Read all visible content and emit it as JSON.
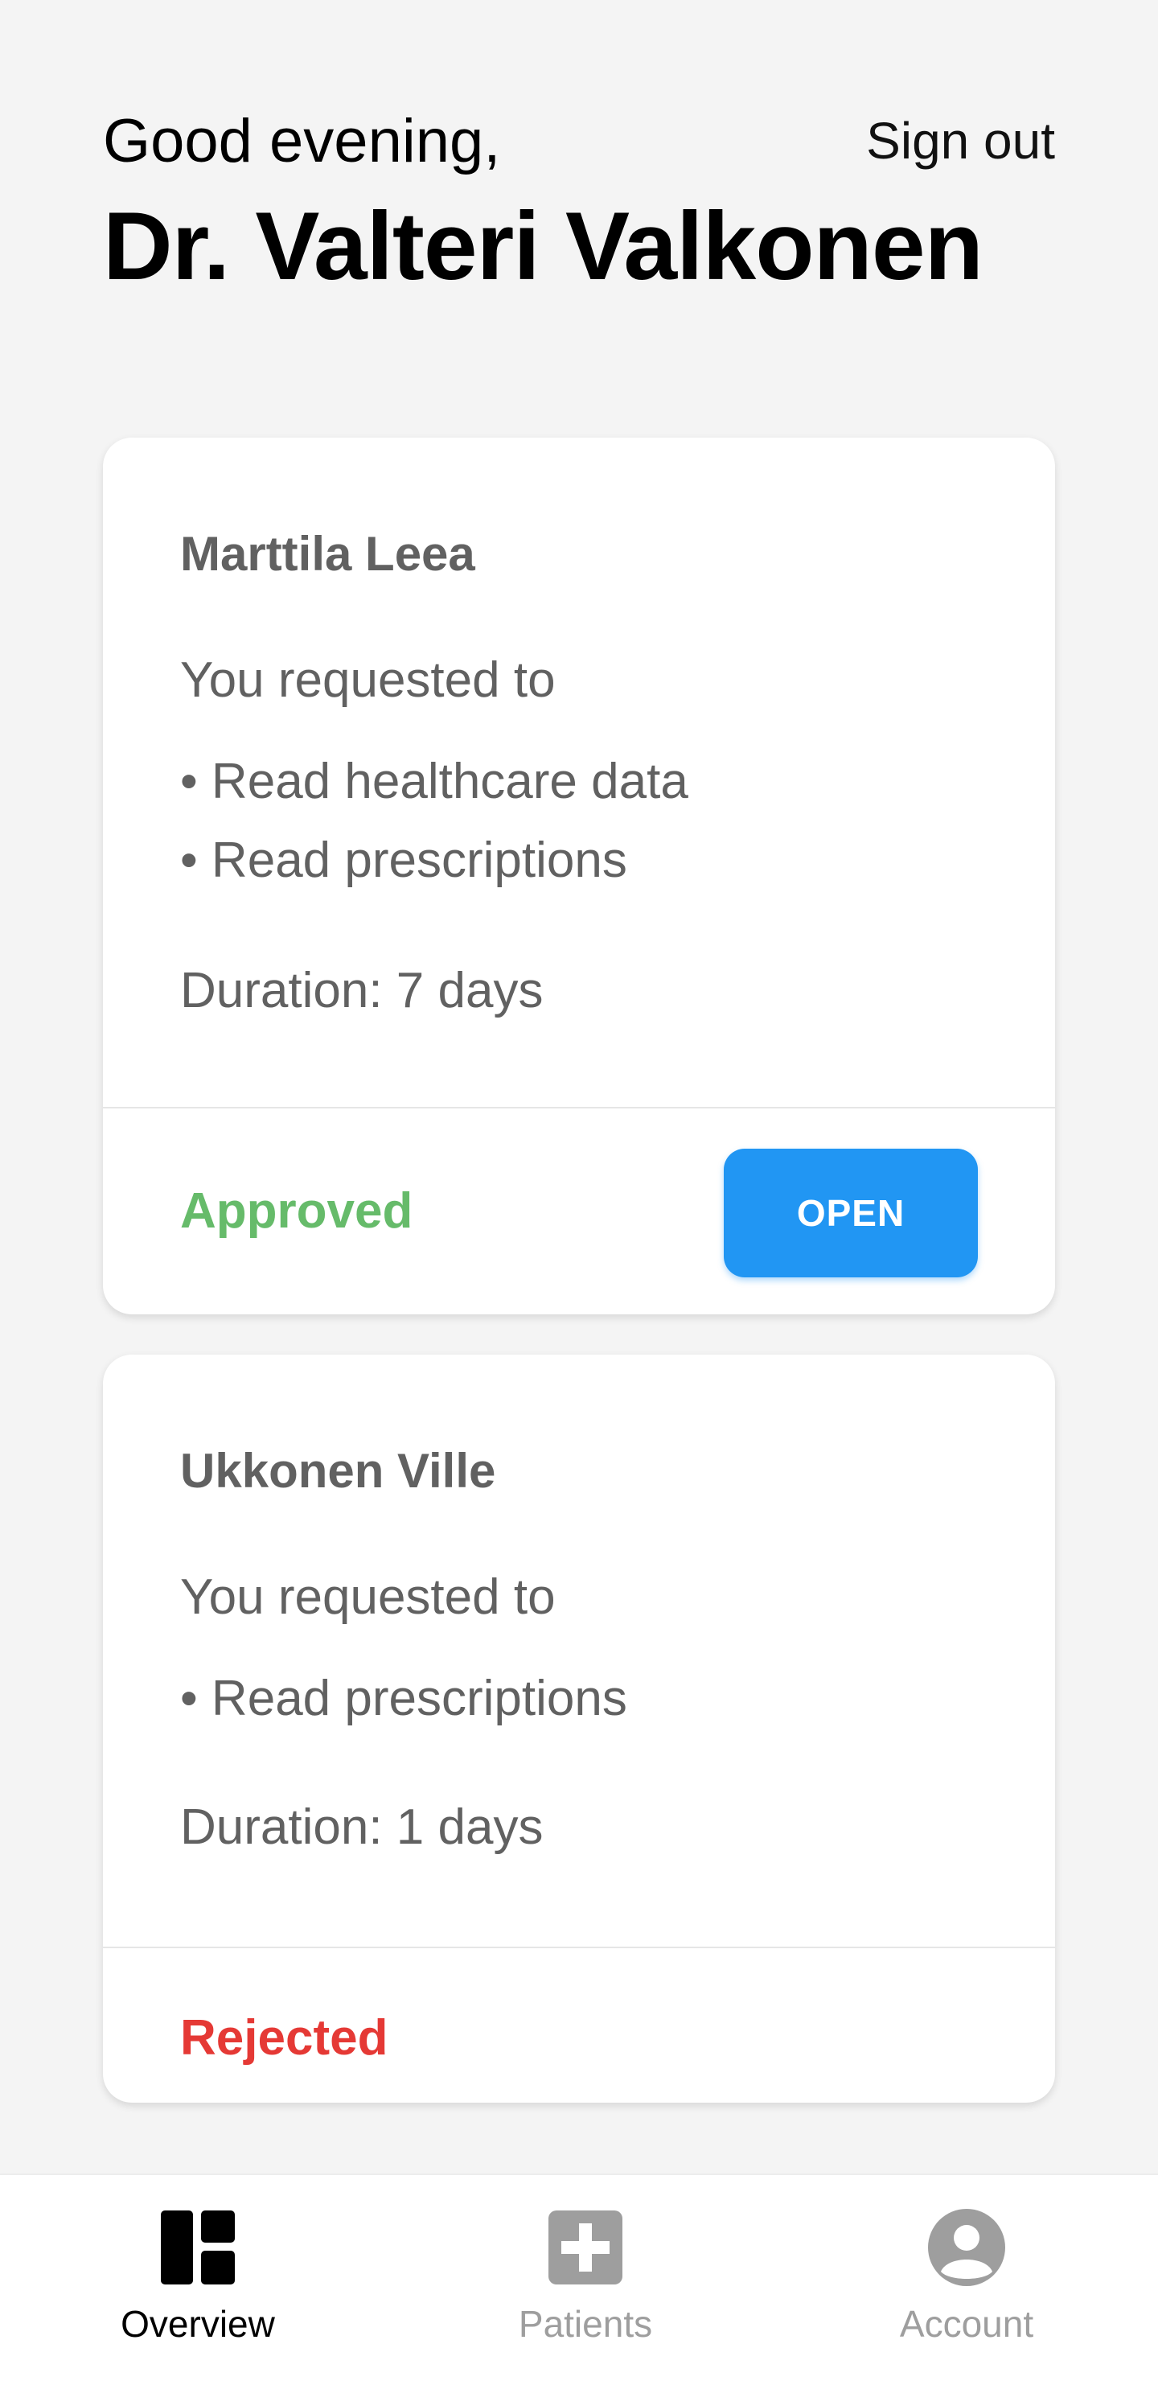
{
  "header": {
    "greeting": "Good evening,",
    "doctor_name": "Dr. Valteri Valkonen",
    "sign_out_label": "Sign out"
  },
  "requests": [
    {
      "patient_name": "Marttila Leea",
      "intro": "You requested to",
      "permissions": [
        "• Read healthcare data",
        "• Read prescriptions"
      ],
      "duration": "Duration: 7 days",
      "status": "Approved",
      "status_color": "#66bb6a",
      "action_label": "OPEN"
    },
    {
      "patient_name": "Ukkonen Ville",
      "intro": "You requested to",
      "permissions": [
        "• Read prescriptions"
      ],
      "duration": "Duration: 1 days",
      "status": "Rejected",
      "status_color": "#e53935"
    }
  ],
  "bottom_nav": {
    "items": [
      {
        "label": "Overview",
        "icon": "dashboard-icon",
        "active": true
      },
      {
        "label": "Patients",
        "icon": "medical-cross-icon",
        "active": false
      },
      {
        "label": "Account",
        "icon": "account-circle-icon",
        "active": false
      }
    ]
  },
  "colors": {
    "accent": "#2196f3",
    "approved": "#66bb6a",
    "rejected": "#e53935",
    "background": "#f4f4f4"
  }
}
